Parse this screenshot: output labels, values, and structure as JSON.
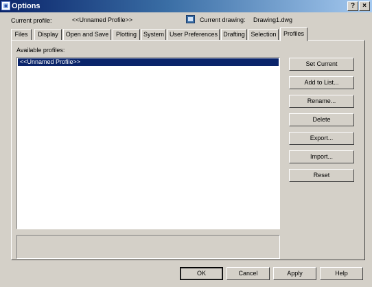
{
  "window": {
    "title": "Options",
    "help_btn": "?",
    "close_btn": "×"
  },
  "header": {
    "profile_label": "Current profile:",
    "profile_value": "<<Unnamed Profile>>",
    "drawing_label": "Current drawing:",
    "drawing_value": "Drawing1.dwg"
  },
  "tabs": [
    {
      "label": "Files"
    },
    {
      "label": "Display"
    },
    {
      "label": "Open and Save"
    },
    {
      "label": "Plotting"
    },
    {
      "label": "System"
    },
    {
      "label": "User Preferences"
    },
    {
      "label": "Drafting"
    },
    {
      "label": "Selection"
    },
    {
      "label": "Profiles",
      "active": true
    }
  ],
  "profiles": {
    "available_label": "Available profiles:",
    "items": [
      {
        "label": "<<Unnamed Profile>>",
        "selected": true
      }
    ],
    "buttons": {
      "set_current": "Set Current",
      "add_to_list": "Add to List...",
      "rename": "Rename...",
      "delete": "Delete",
      "export": "Export...",
      "import": "Import...",
      "reset": "Reset"
    }
  },
  "footer": {
    "ok": "OK",
    "cancel": "Cancel",
    "apply": "Apply",
    "help": "Help"
  },
  "colors": {
    "face": "#d4d0c8",
    "selection": "#0a246a",
    "title_start": "#0a246a"
  }
}
